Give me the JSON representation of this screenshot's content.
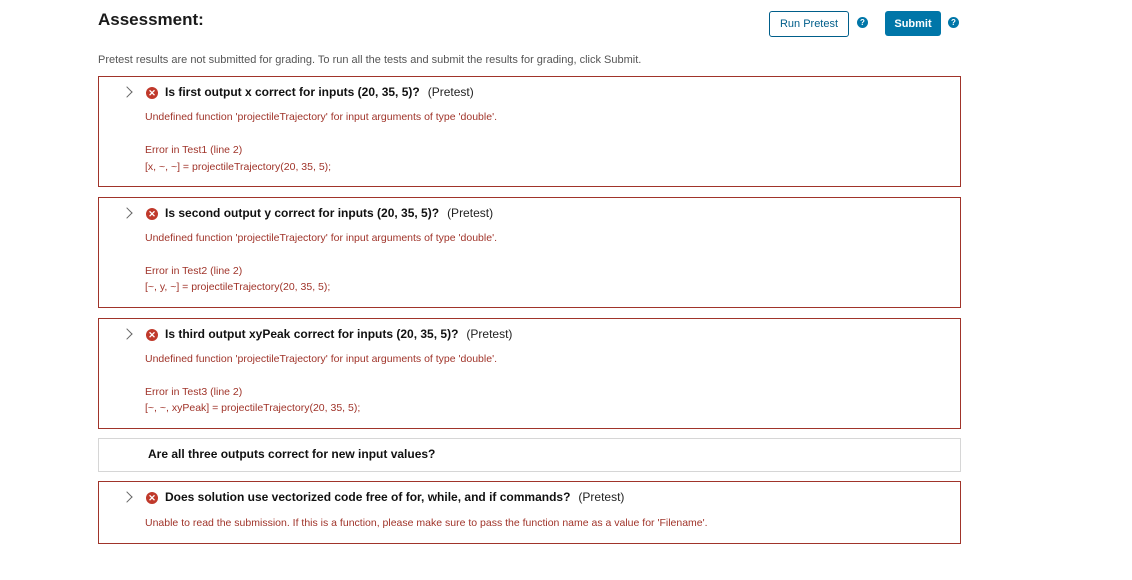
{
  "header": {
    "title": "Assessment:",
    "run_pretest_label": "Run Pretest",
    "submit_label": "Submit",
    "help_glyph": "?"
  },
  "note": "Pretest results are not submitted for grading. To run all the tests and submit the results for grading, click Submit.",
  "tests": [
    {
      "question": "Is first output x correct for inputs (20, 35, 5)?",
      "tag": "(Pretest)",
      "message": "Undefined function 'projectileTrajectory' for input arguments of type 'double'.",
      "error_location": "Error in Test1 (line 2)",
      "error_code": "[x, ~, ~] = projectileTrajectory(20, 35, 5);"
    },
    {
      "question": "Is second output y correct for inputs (20, 35, 5)?",
      "tag": "(Pretest)",
      "message": "Undefined function 'projectileTrajectory' for input arguments of type 'double'.",
      "error_location": "Error in Test2 (line 2)",
      "error_code": "[~, y, ~] = projectileTrajectory(20, 35, 5);"
    },
    {
      "question": "Is third output xyPeak correct for inputs (20, 35, 5)?",
      "tag": "(Pretest)",
      "message": "Undefined function 'projectileTrajectory' for input arguments of type 'double'.",
      "error_location": "Error in Test3 (line 2)",
      "error_code": "[~, ~, xyPeak] = projectileTrajectory(20, 35, 5);"
    },
    {
      "question": "Are all three outputs correct for new input values?"
    },
    {
      "question": "Does solution use vectorized code free of for, while, and if commands?",
      "tag": "(Pretest)",
      "message": "Unable to read the submission. If this is a function, please make sure to pass the function name as a value for 'Filename'."
    }
  ],
  "icons": {
    "error_glyph": "✕"
  },
  "colors": {
    "accent": "#0076a8",
    "error": "#a0342a",
    "error_icon": "#c0392b"
  }
}
